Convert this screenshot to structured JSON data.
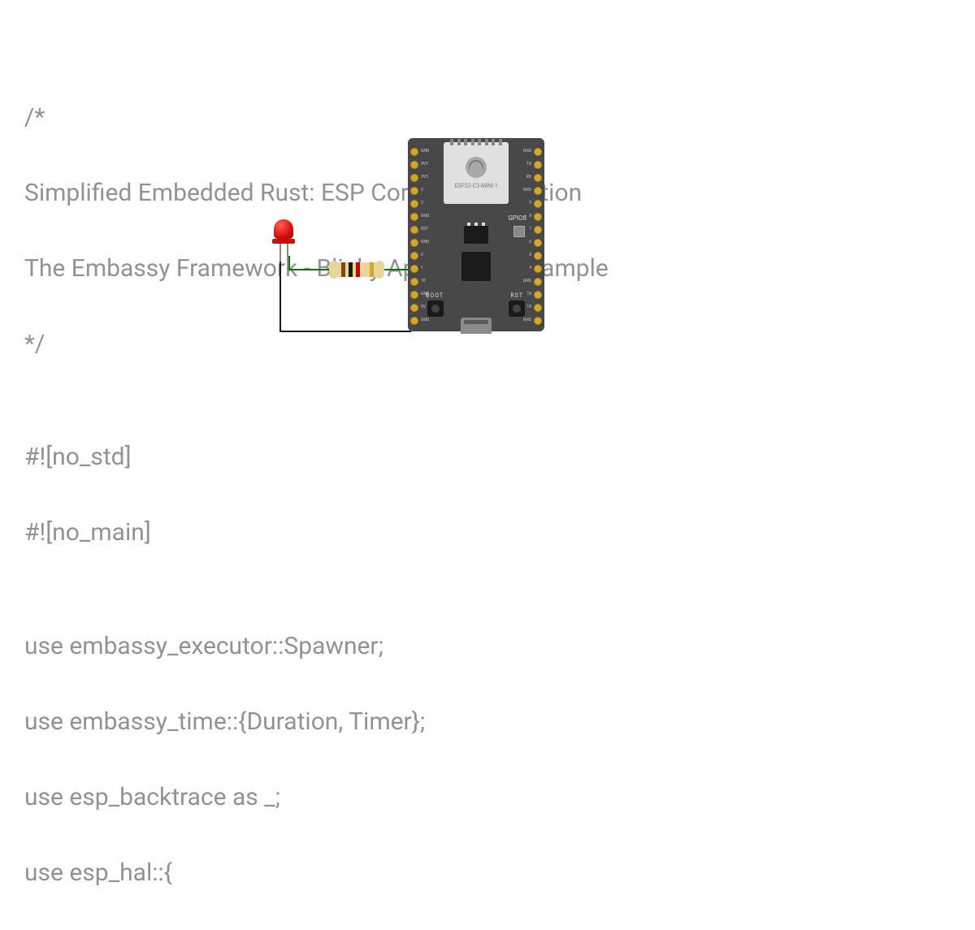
{
  "code": {
    "line1": "/*",
    "line2": "Simplified Embedded Rust: ESP Core Library Edition",
    "line3": "The Embassy Framework - Blinky Application Example",
    "line4": "*/",
    "line5": "",
    "line6": "#![no_std]",
    "line7": "#![no_main]",
    "line8": "",
    "line9": "use embassy_executor::Spawner;",
    "line10": "use embassy_time::{Duration, Timer};",
    "line11": "use esp_backtrace as _;",
    "line12": "use esp_hal::{"
  },
  "board": {
    "chip_model": "ESP32-C3-MINI-1",
    "gpio_label": "GPIO8",
    "boot_label": "BOOT",
    "rst_label": "RST",
    "left_pins": [
      "GND",
      "3V3",
      "3V3",
      "2",
      "3",
      "GND",
      "RST",
      "GND",
      "0",
      "1",
      "10",
      "GND",
      "5V",
      "GND"
    ],
    "right_pins": [
      "GND",
      "TX",
      "RX",
      "GND",
      "9",
      "8",
      "7",
      "6",
      "5",
      "4",
      "GND",
      "18",
      "19",
      "GND"
    ]
  },
  "components": {
    "led": "red-led",
    "resistor": "resistor-220ohm"
  }
}
